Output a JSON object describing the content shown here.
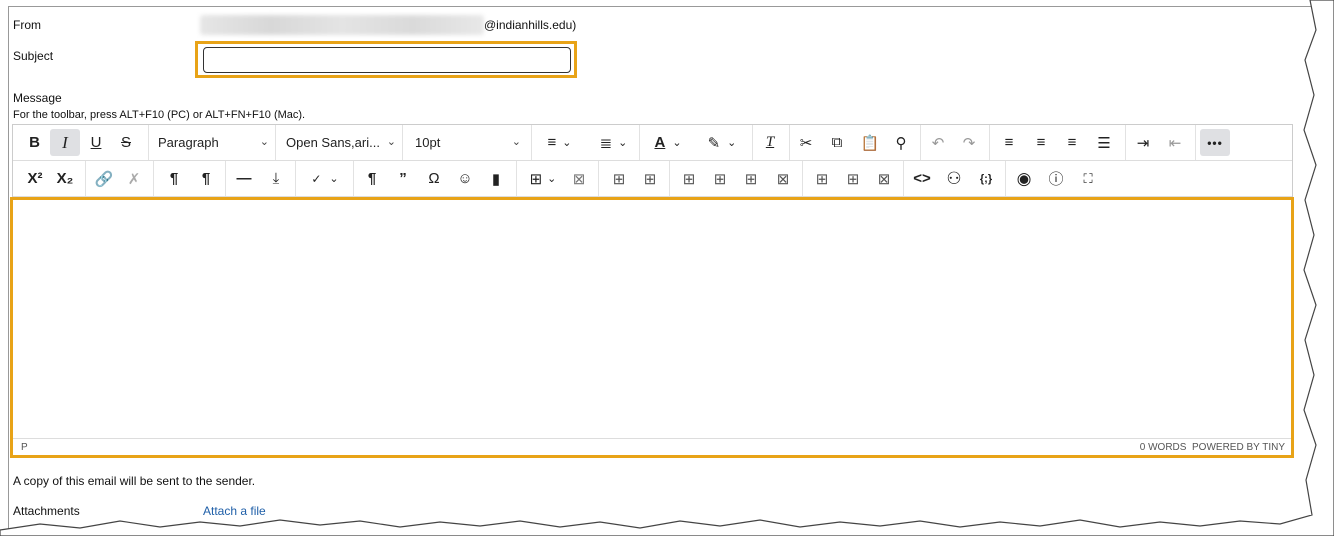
{
  "form": {
    "from_label": "From",
    "from_domain": "@indianhills.edu)",
    "subject_label": "Subject",
    "subject_value": "",
    "message_label": "Message",
    "toolbar_hint": "For the toolbar, press ALT+F10 (PC) or ALT+FN+F10 (Mac).",
    "copy_note": "A copy of this email will be sent to the sender.",
    "attachments_label": "Attachments",
    "attach_link": "Attach a file"
  },
  "toolbar": {
    "bold": "B",
    "italic": "I",
    "underline": "U",
    "strike": "S",
    "block_format": "Paragraph",
    "font_family": "Open Sans,ari...",
    "font_size": "10pt",
    "more": "•••",
    "superscript": "X²",
    "subscript": "X₂"
  },
  "statusbar": {
    "path": "P",
    "wordcount": "0 WORDS",
    "powered": "POWERED BY TINY"
  },
  "colors": {
    "highlight": "#e8a317",
    "link": "#1f5fa8"
  }
}
